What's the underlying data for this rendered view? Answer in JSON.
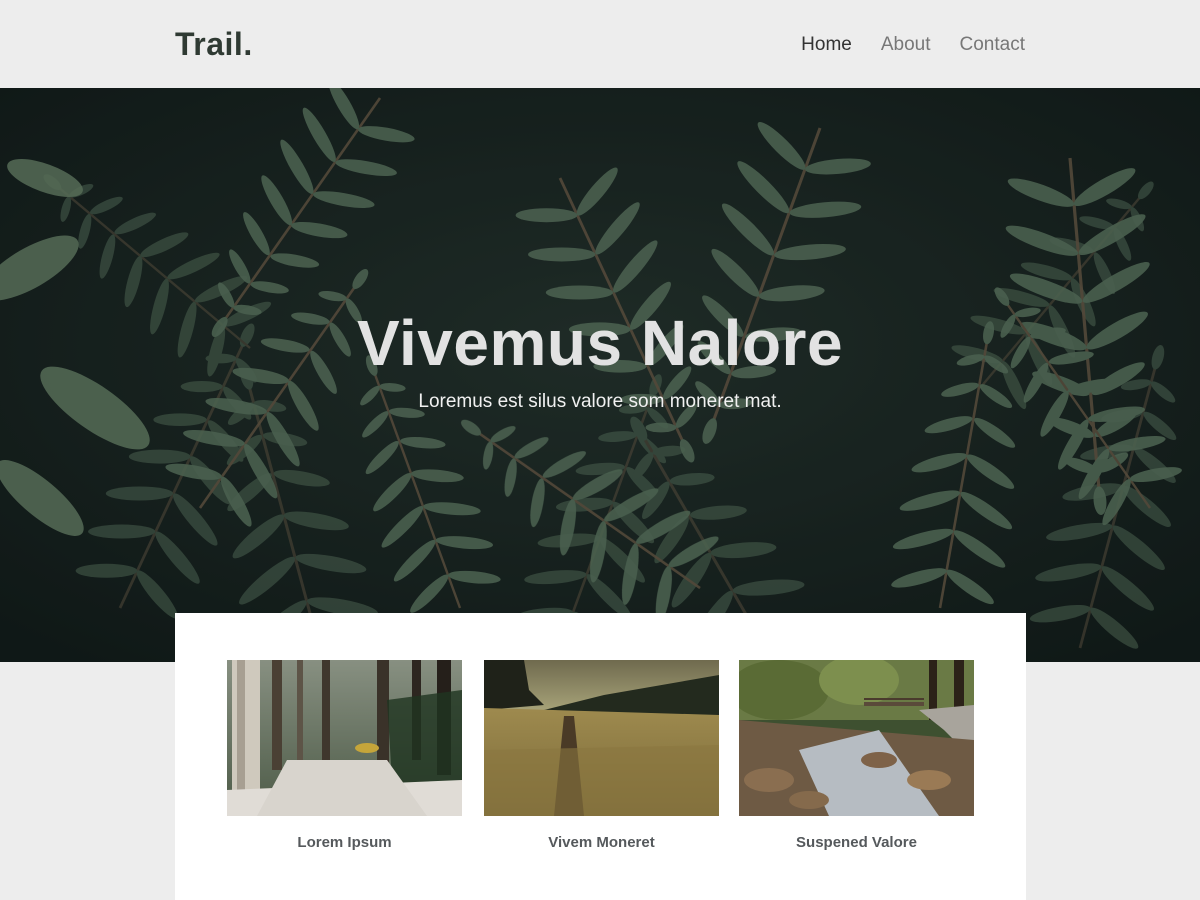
{
  "header": {
    "logo": "Trail.",
    "nav": [
      "Home",
      "About",
      "Contact"
    ]
  },
  "hero": {
    "title": "Vivemus Nalore",
    "subtitle": "Loremus est silus valore som moneret mat."
  },
  "cards": [
    {
      "label": "Lorem Ipsum"
    },
    {
      "label": "Vivem Moneret"
    },
    {
      "label": "Suspened Valore"
    }
  ],
  "colors": {
    "page_bg": "#ededed",
    "hero_dark": "#1d2a26",
    "fern_green": "#5f7a63",
    "text_dark": "#2f3a33"
  }
}
